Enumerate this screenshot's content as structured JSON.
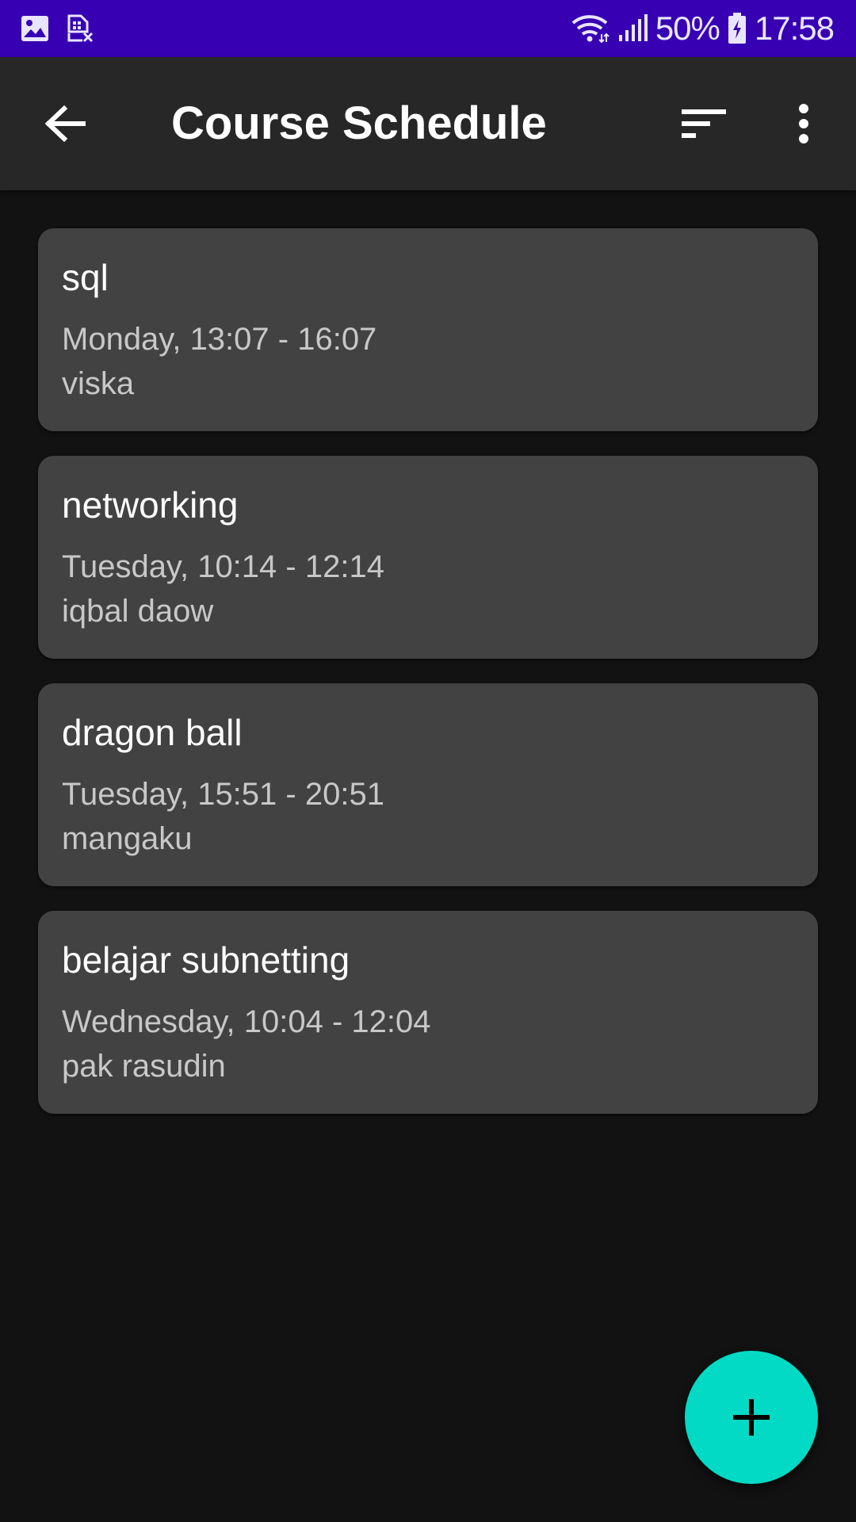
{
  "status_bar": {
    "left_icons": [
      "gallery-icon",
      "sim-card-off-icon"
    ],
    "right_icons": [
      "wifi-icon",
      "signal-icon",
      "battery-charging-icon"
    ],
    "battery": "50%",
    "time": "17:58",
    "background": "#3700b3"
  },
  "app_bar": {
    "title": "Course Schedule",
    "back_icon": "arrow-back-icon",
    "sort_icon": "sort-icon",
    "more_icon": "more-vert-icon",
    "background": "#272727"
  },
  "courses": [
    {
      "name": "sql",
      "time": "Monday, 13:07 - 16:07",
      "lecturer": "viska"
    },
    {
      "name": "networking",
      "time": "Tuesday, 10:14 - 12:14",
      "lecturer": "iqbal daow"
    },
    {
      "name": "dragon ball",
      "time": "Tuesday, 15:51 - 20:51",
      "lecturer": "mangaku"
    },
    {
      "name": "belajar subnetting",
      "time": "Wednesday, 10:04 - 12:04",
      "lecturer": "pak rasudin"
    }
  ],
  "fab": {
    "icon": "add-icon",
    "color": "#03dac5"
  },
  "colors": {
    "background": "#121212",
    "card": "#424242",
    "secondary_text": "#c8c8c8"
  }
}
